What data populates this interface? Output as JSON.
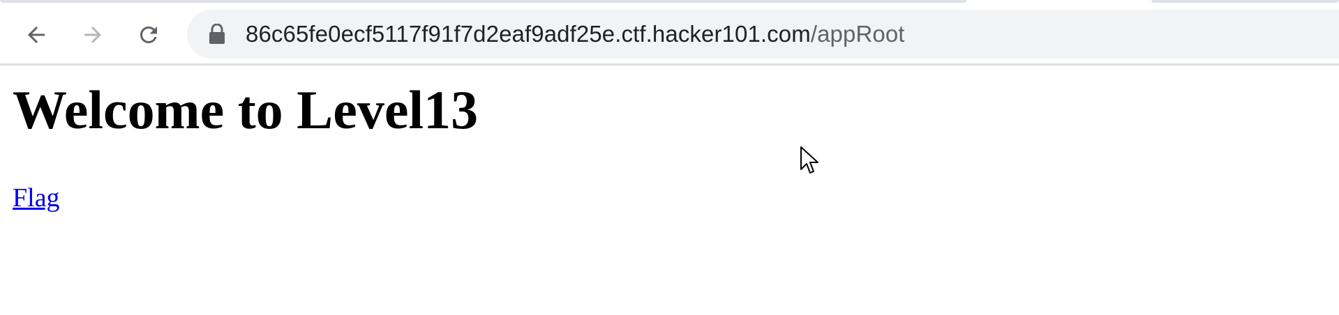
{
  "browser": {
    "url_host": "86c65fe0ecf5117f91f7d2eaf9adf25e.ctf.hacker101.com",
    "url_path": "/appRoot",
    "icons": {
      "back": "back-arrow-icon",
      "forward": "forward-arrow-icon",
      "reload": "reload-icon",
      "lock": "lock-icon"
    },
    "colors": {
      "omnibox_bg": "#f1f3f4",
      "host_text": "#202124",
      "path_text": "#5f6368",
      "forward_disabled": "#b4b7ba"
    }
  },
  "page": {
    "heading": "Welcome to Level13",
    "link_label": "Flag",
    "colors": {
      "link": "#0000ee",
      "text": "#000000"
    }
  },
  "cursor": {
    "icon": "mouse-pointer-icon"
  }
}
